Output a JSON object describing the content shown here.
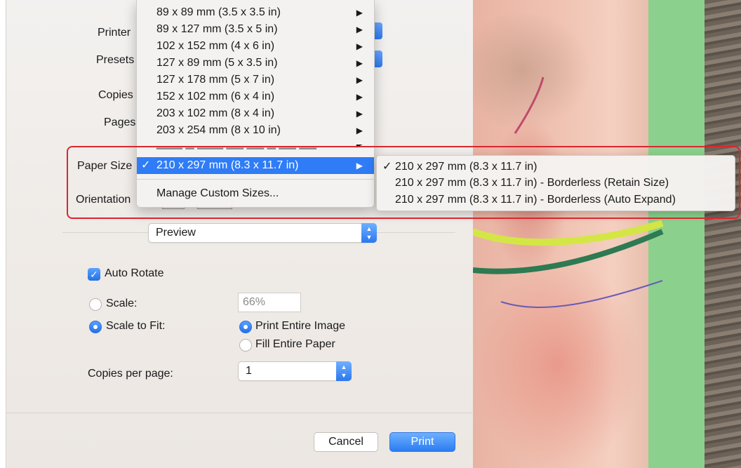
{
  "dialog": {
    "labels": {
      "printer": "Printer",
      "presets": "Presets",
      "copies": "Copies",
      "pages": "Pages",
      "paper_size": "Paper Size",
      "orientation": "Orientation"
    },
    "section_select": {
      "value": "Preview",
      "icon": "stepper-icon"
    },
    "auto_rotate": {
      "label": "Auto Rotate",
      "checked": true
    },
    "scale": {
      "label": "Scale:",
      "value": "66%",
      "selected": false
    },
    "scale_to_fit": {
      "label": "Scale to Fit:",
      "selected": true
    },
    "print_entire_image": {
      "label": "Print Entire Image",
      "selected": true
    },
    "fill_entire_paper": {
      "label": "Fill Entire Paper",
      "selected": false
    },
    "copies_per_page": {
      "label": "Copies per page:",
      "value": "1"
    },
    "buttons": {
      "cancel": "Cancel",
      "print": "Print"
    }
  },
  "paper_menu": {
    "items": [
      {
        "label": "89 x 89 mm (3.5 x 3.5 in)",
        "arrow": "▶"
      },
      {
        "label": "89 x 127 mm (3.5 x 5 in)",
        "arrow": "▶"
      },
      {
        "label": "102 x 152 mm (4 x 6 in)",
        "arrow": "▶"
      },
      {
        "label": "127 x 89 mm (5 x 3.5 in)",
        "arrow": "▶"
      },
      {
        "label": "127 x 178 mm (5 x 7 in)",
        "arrow": "▶"
      },
      {
        "label": "152 x 102 mm (6 x 4 in)",
        "arrow": "▶"
      },
      {
        "label": "203 x 102 mm (8 x 4 in)",
        "arrow": "▶"
      },
      {
        "label": "203 x 254 mm (8 x 10 in)",
        "arrow": "▶"
      }
    ],
    "selected": {
      "check": "✓",
      "label": "210 x 297 mm (8.3 x 11.7 in)",
      "arrow": "▶"
    },
    "manage": "Manage Custom Sizes..."
  },
  "submenu": {
    "items": [
      {
        "check": "✓",
        "label": "210 x 297 mm (8.3 x 11.7 in)"
      },
      {
        "check": "",
        "label": "210 x 297 mm (8.3 x 11.7 in) - Borderless (Retain Size)"
      },
      {
        "check": "",
        "label": "210 x 297 mm (8.3 x 11.7 in) - Borderless (Auto Expand)"
      }
    ]
  },
  "colors": {
    "accent": "#2f7cf6",
    "highlight_box": "#d8272f"
  }
}
